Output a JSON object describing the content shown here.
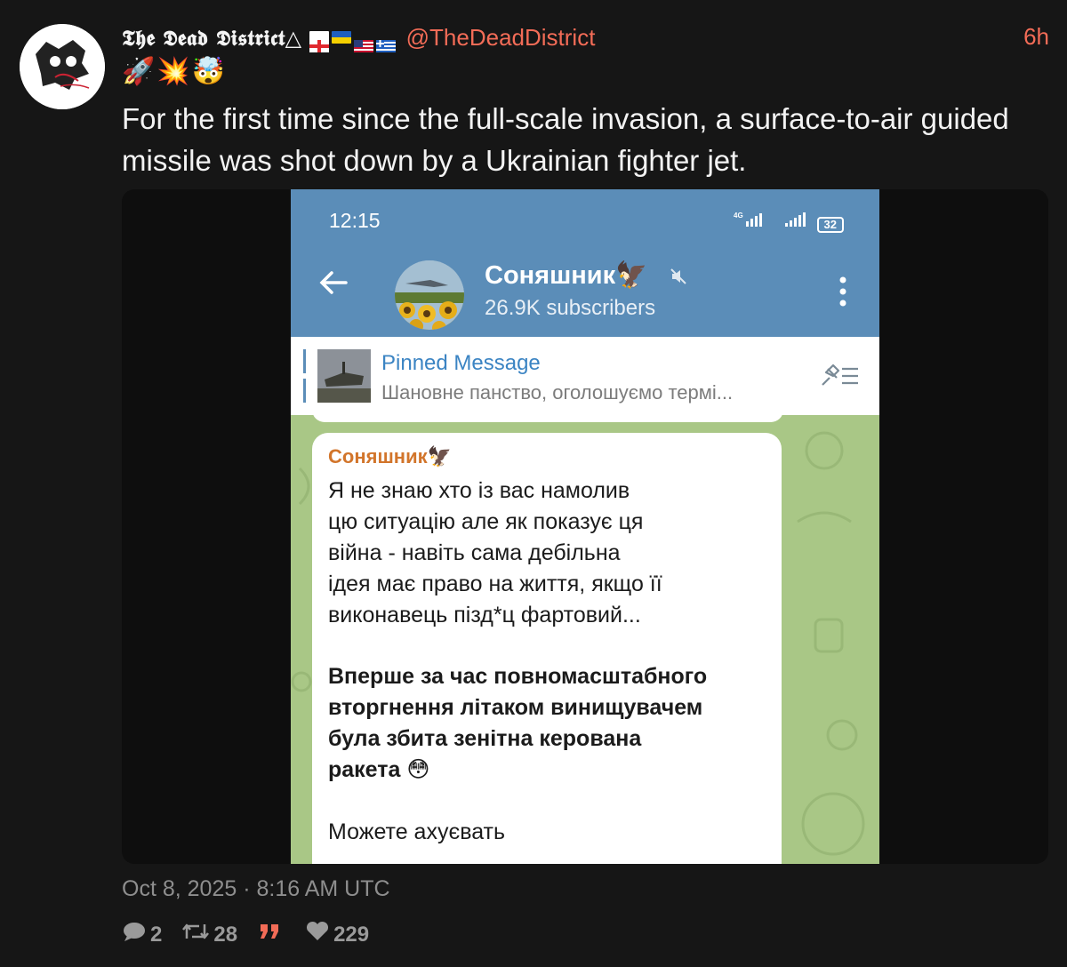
{
  "author": {
    "display_name": "𝕿𝖍𝖊 𝕯𝖊𝖆𝖉 𝕯𝖎𝖘𝖙𝖗𝖎𝖈𝖙△",
    "flags": [
      "georgia",
      "ukraine",
      "usa",
      "greece"
    ],
    "handle": "@TheDeadDistrict",
    "time_ago": "6h"
  },
  "emojis": [
    "🚀",
    "💥",
    "🤯"
  ],
  "text": "For the first time since the full-scale invasion, a surface-to-air guided missile was shot down by a Ukrainian fighter jet.",
  "screenshot": {
    "status_time": "12:15",
    "network_label": "4G",
    "battery": "32",
    "channel_name": "Соняшник🦅",
    "subscribers": "26.9K subscribers",
    "pinned_title": "Pinned Message",
    "pinned_text": "Шановне панство, оголошуємо термі...",
    "message": {
      "sender": "Соняшник🦅",
      "para1": "Я не знаю хто із вас намолив\nцю ситуацію але як показує ця\nвійна - навіть сама дебільна\nідея має право на життя, якщо її\nвиконавець пізд*ц фартовий...",
      "para2": "Вперше за час повномасштабного\nвторгнення літаком винищувачем\nбула збита зенітна керована\nракета 😳",
      "para3": "Можете ахуєвать"
    }
  },
  "date": "Oct 8, 2025 · 8:16 AM UTC",
  "stats": {
    "replies": "2",
    "retweets": "28",
    "quotes": "",
    "likes": "229"
  },
  "colors": {
    "accent": "#f36c57",
    "telegram_header": "#5b8db8",
    "chat_bg": "#a9c786"
  }
}
